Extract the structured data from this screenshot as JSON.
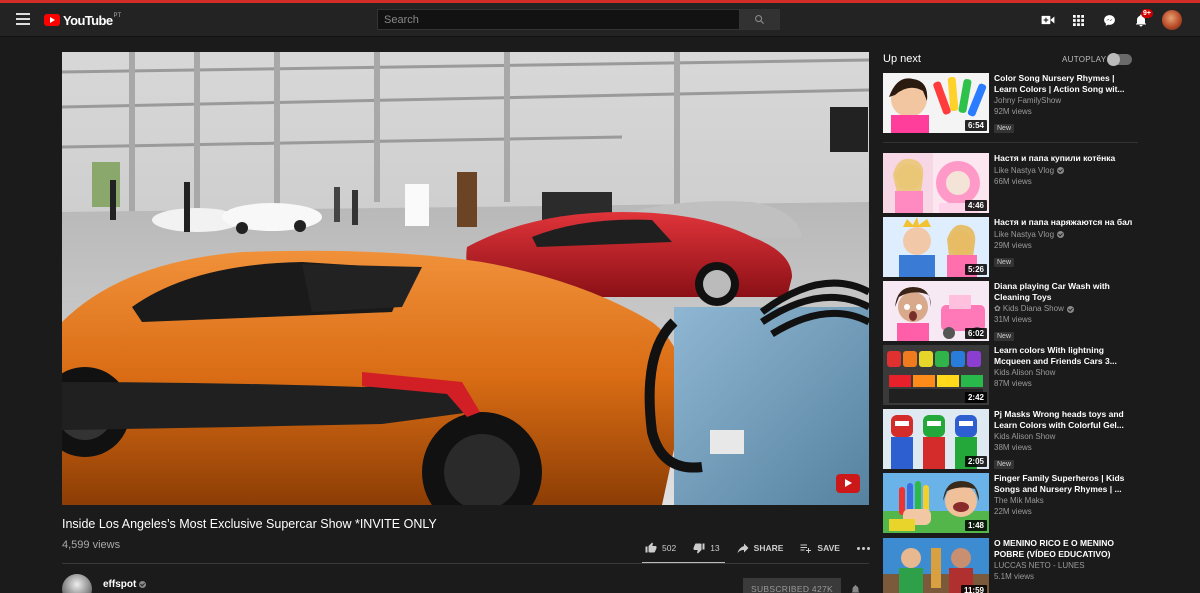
{
  "header": {
    "logo_text": "YouTube",
    "logo_country": "PT",
    "search_placeholder": "Search",
    "notifications_count": "9+"
  },
  "video": {
    "title": "Inside Los Angeles’s Most Exclusive Supercar Show *INVITE ONLY",
    "views": "4,599 views",
    "likes": "502",
    "dislikes": "13",
    "share_label": "SHARE",
    "save_label": "SAVE"
  },
  "channel": {
    "name": "effspot",
    "subscribe_label": "SUBSCRIBED  427K"
  },
  "sidebar": {
    "up_next_label": "Up next",
    "autoplay_label": "AUTOPLAY",
    "autoplay_on": false,
    "items": [
      {
        "title": "Color Song Nursery Rhymes | Learn Colors | Action Song wit...",
        "channel": "Johny FamilyShow",
        "views": "92M views",
        "duration": "6:54",
        "badge": "New",
        "verified": false
      },
      {
        "title": "Настя и папа купили котёнка",
        "channel": "Like Nastya Vlog",
        "views": "66M views",
        "duration": "4:46",
        "badge": "",
        "verified": true
      },
      {
        "title": "Настя и папа наряжаются на бал",
        "channel": "Like Nastya Vlog",
        "views": "29M views",
        "duration": "5:26",
        "badge": "New",
        "verified": true
      },
      {
        "title": "Diana playing Car Wash with Cleaning Toys",
        "channel": "✿ Kids Diana Show",
        "views": "31M views",
        "duration": "6:02",
        "badge": "New",
        "verified": true
      },
      {
        "title": "Learn colors With lightning Mcqueen and Friends Cars 3...",
        "channel": "Kids Alison Show",
        "views": "87M views",
        "duration": "2:42",
        "badge": "",
        "verified": false
      },
      {
        "title": "Pj Masks Wrong heads toys and Learn Colors with Colorful Gel...",
        "channel": "Kids Alison Show",
        "views": "38M views",
        "duration": "2:05",
        "badge": "New",
        "verified": false
      },
      {
        "title": "Finger Family Superheros | Kids Songs and Nursery Rhymes | ...",
        "channel": "The Mik Maks",
        "views": "22M views",
        "duration": "1:48",
        "badge": "",
        "verified": false
      },
      {
        "title": "O MENINO RICO E O MENINO POBRE (VÍDEO EDUCATIVO)",
        "channel": "LUCCAS NETO - LUNES",
        "views": "5.1M views",
        "duration": "11:59",
        "badge": "",
        "verified": false
      }
    ]
  }
}
